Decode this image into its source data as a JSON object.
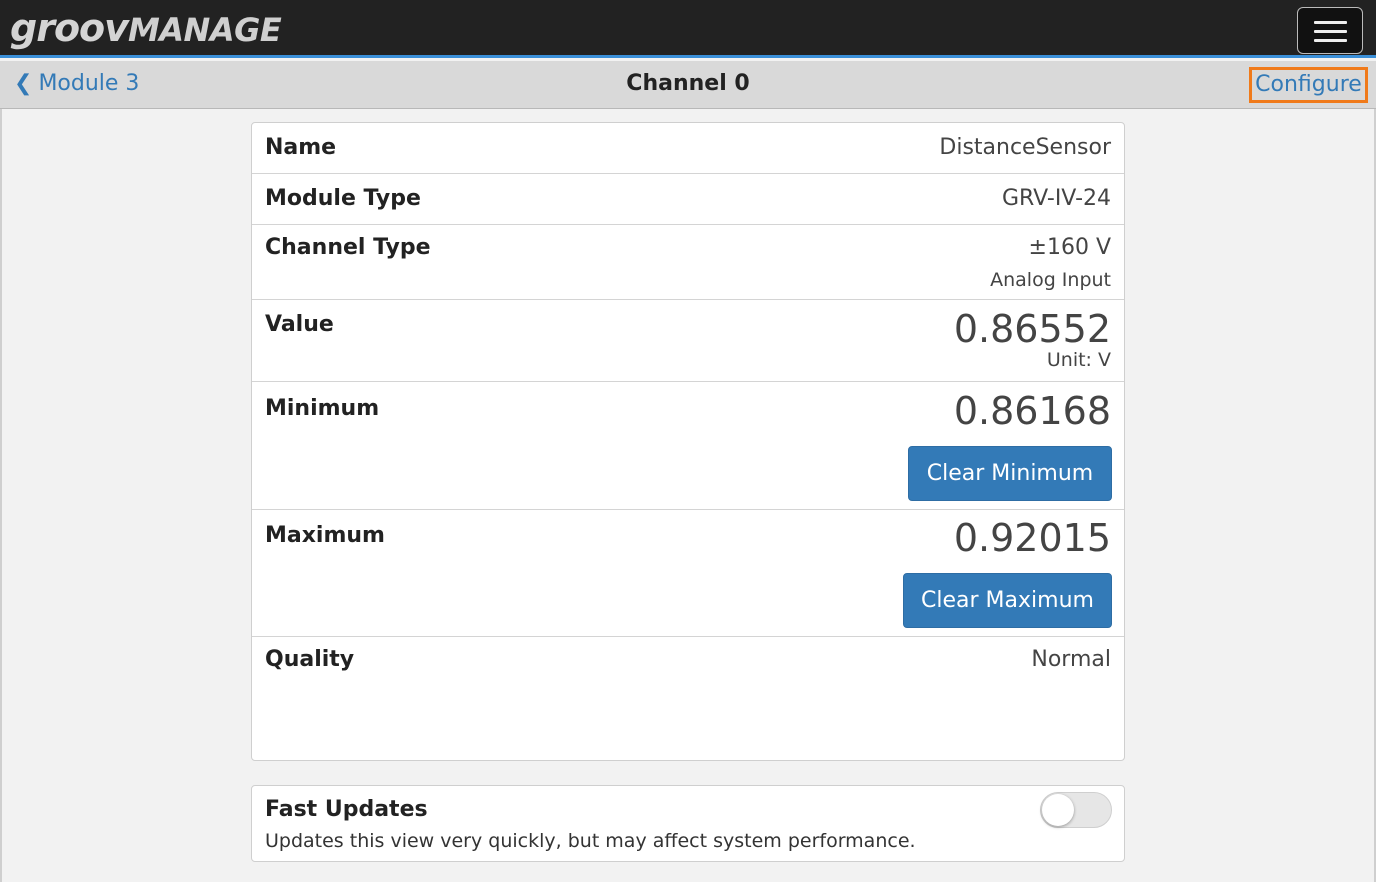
{
  "app": {
    "logo_groov": "groov",
    "logo_manage": "MANAGE"
  },
  "header": {
    "menu_icon": "hamburger-menu-icon"
  },
  "nav": {
    "back_label": "Module 3",
    "back_icon": "chevron-left-icon",
    "title": "Channel 0",
    "configure_label": "Configure"
  },
  "details": {
    "name": {
      "label": "Name",
      "value": "DistanceSensor"
    },
    "module_type": {
      "label": "Module Type",
      "value": "GRV-IV-24"
    },
    "channel_type": {
      "label": "Channel Type",
      "value": "±160 V",
      "sub": "Analog Input"
    },
    "value": {
      "label": "Value",
      "value": "0.86552",
      "unit": "Unit: V"
    },
    "minimum": {
      "label": "Minimum",
      "value": "0.86168",
      "button": "Clear Minimum"
    },
    "maximum": {
      "label": "Maximum",
      "value": "0.92015",
      "button": "Clear Maximum"
    },
    "quality": {
      "label": "Quality",
      "value": "Normal"
    }
  },
  "fast_updates": {
    "title": "Fast Updates",
    "description": "Updates this view very quickly, but may affect system performance.",
    "enabled": false
  },
  "colors": {
    "accent": "#337ab7",
    "highlight": "#f07a1a",
    "topbar": "#222222"
  }
}
